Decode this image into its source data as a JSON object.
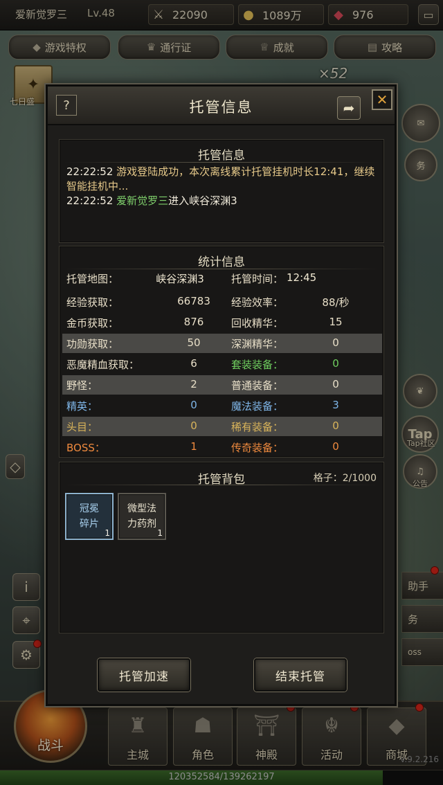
{
  "top_bar": {
    "player_name": "爱新觉罗三",
    "level": "Lv.48",
    "power_value": "22090",
    "gold_value": "1089万",
    "gem_value": "976"
  },
  "top_tabs": [
    "游戏特权",
    "通行证",
    "成就",
    "攻略"
  ],
  "background": {
    "combo_text": "×52",
    "event_label": "七日盛",
    "right_widget_2": "务",
    "tap_label": "Tap",
    "tap_sub": "Tap社区",
    "notice_label": "公告",
    "strip_1": "助手",
    "strip_2": "务",
    "strip_3": "oss"
  },
  "dialog": {
    "title": "托管信息",
    "help_label": "?",
    "info_panel": {
      "title": "托管信息",
      "log": [
        {
          "time": "22:22:52",
          "text": "游戏登陆成功，本次离线累计托管挂机时长12:41，继续智能挂机中..."
        },
        {
          "time": "22:22:52",
          "player": "爱新觉罗三",
          "text": "进入峡谷深渊3"
        }
      ]
    },
    "stats_panel": {
      "title": "统计信息",
      "map_label": "托管地图：",
      "map_value": "峡谷深渊3",
      "time_label": "托管时间：",
      "time_value": "12:45",
      "rows": [
        {
          "label": "经验获取：",
          "value": "66783",
          "label2": "经验效率：",
          "value2": "88/秒",
          "highlight": false
        },
        {
          "label": "金币获取：",
          "value": "876",
          "label2": "回收精华：",
          "value2": "15",
          "highlight": false
        },
        {
          "label": "功勋获取：",
          "value": "50",
          "label2": "深渊精华：",
          "value2": "0",
          "highlight": true
        },
        {
          "label": "恶魔精血获取：",
          "value": "6",
          "label2": "套装装备：",
          "value2": "0",
          "highlight": false
        },
        {
          "label": "野怪：",
          "value": "2",
          "label2": "普通装备：",
          "value2": "0",
          "highlight": true
        },
        {
          "label": "精英：",
          "value": "0",
          "label2": "魔法装备：",
          "value2": "3",
          "highlight": false
        },
        {
          "label": "头目：",
          "value": "0",
          "label2": "稀有装备：",
          "value2": "0",
          "highlight": true
        },
        {
          "label": "BOSS：",
          "value": "1",
          "label2": "传奇装备：",
          "value2": "0",
          "highlight": false
        }
      ]
    },
    "bag_panel": {
      "title": "托管背包",
      "capacity": "格子：2/1000",
      "items": [
        {
          "name_line1": "冠冕",
          "name_line2": "碎片",
          "count": "1"
        },
        {
          "name_line1": "微型法",
          "name_line2": "力药剂",
          "count": "1"
        }
      ]
    },
    "buttons": {
      "speed_up": "托管加速",
      "end": "结束托管"
    }
  },
  "bottom_nav": {
    "battle": "战斗",
    "items": [
      "主城",
      "角色",
      "神殿",
      "活动",
      "商城"
    ]
  },
  "exp": {
    "text": "120352584/139262197",
    "fraction": 0.864
  },
  "version": "v.9.2.216",
  "colors": {
    "exp_label": "#e8dfc8",
    "gold_label": "#e8dfc8",
    "suit": "#6fcf5f",
    "elite": "#7fb6e8",
    "magic": "#7fb6e8",
    "boss_label": "#ef8a3e",
    "legend": "#ef8a3e",
    "chief": "#d9b45a",
    "rare": "#d9b45a",
    "wild": "#e8dfc8"
  }
}
